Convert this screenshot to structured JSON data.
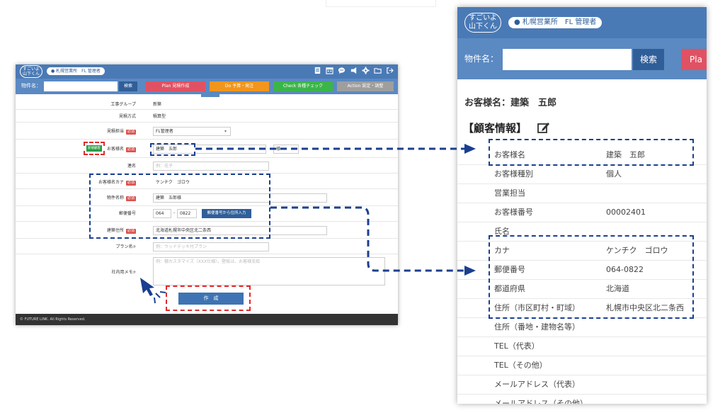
{
  "app": {
    "logo_line1": "すごいよ",
    "logo_line2": "山下くん",
    "org": "札幌営業所",
    "role": "FL 管理者",
    "org_full": "札幌営業所　FL 管理者"
  },
  "search": {
    "label": "物件名：",
    "button": "検索"
  },
  "tabs": [
    {
      "label": "Plan 見積作成",
      "color": "#e05263"
    },
    {
      "label": "Do 予算・発注",
      "color": "#f0961e"
    },
    {
      "label": "Check 各種チェック",
      "color": "#3bb54a"
    },
    {
      "label": "Action 設定・調整",
      "color": "#9e9e9e"
    }
  ],
  "form": {
    "construction_group": {
      "label": "工事グループ",
      "value": "新築"
    },
    "estimate_method": {
      "label": "見積方式",
      "value": "積算型"
    },
    "estimate_owner": {
      "label": "見積担当",
      "required": "必須",
      "value": "FL管理者"
    },
    "customer_name": {
      "label": "お客様名",
      "required": "必須",
      "last": "建築",
      "first": "五郎",
      "suffix": "様"
    },
    "new_badge": "新規顧客",
    "joint_name": {
      "label": "連名",
      "placeholder": "例：花子"
    },
    "kana": {
      "label": "お客様名カナ",
      "required": "必須",
      "value": "ケンチク　ゴロウ"
    },
    "property_name": {
      "label": "物件名称",
      "required": "必須",
      "value": "建築　五郎様"
    },
    "postal": {
      "label": "郵便番号",
      "part1": "064",
      "part2": "0822",
      "button": "郵便番号から住所入力"
    },
    "address": {
      "label": "建築住所",
      "required": "必須",
      "value": "北海道札幌市中央区北二条西"
    },
    "plan_name": {
      "label": "プラン名",
      "placeholder": "例：ウッドデッキ付プラン"
    },
    "memo": {
      "label": "社内用メモ",
      "placeholder": "例：棚カスタマイズ（XXX仕様）。壁紙は、お客様支給"
    },
    "create_button": "作　成"
  },
  "footer": "© FUTURE LINK. All Rights Reserved.",
  "zoom": {
    "plan_tab": "Pla",
    "customer_title_label": "お客様名：",
    "customer_title_value": "建築　五郎",
    "section_title": "【顧客情報】",
    "rows": [
      {
        "label": "お客様名",
        "value": "建築　五郎"
      },
      {
        "label": "お客様種別",
        "value": "個人"
      },
      {
        "label": "営業担当",
        "value": ""
      },
      {
        "label": "お客様番号",
        "value": "00002401"
      },
      {
        "label": "氏名",
        "value": ""
      },
      {
        "label": "カナ",
        "value": "ケンチク　ゴロウ"
      },
      {
        "label": "郵便番号",
        "value": "064-0822"
      },
      {
        "label": "都道府県",
        "value": "北海道"
      },
      {
        "label": "住所（市区町村・町域）",
        "value": "札幌市中央区北二条西"
      },
      {
        "label": "住所（番地・建物名等）",
        "value": ""
      },
      {
        "label": "TEL（代表）",
        "value": ""
      },
      {
        "label": "TEL（その他）",
        "value": ""
      },
      {
        "label": "メールアドレス（代表）",
        "value": ""
      },
      {
        "label": "メールアドレス（その他）",
        "value": ""
      }
    ]
  },
  "icons": [
    "document-icon",
    "calendar-icon",
    "chat-icon",
    "megaphone-icon",
    "gear-icon",
    "folder-icon",
    "logout-icon"
  ]
}
